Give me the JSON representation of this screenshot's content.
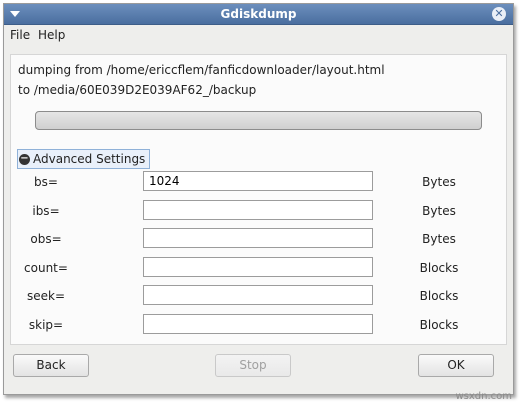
{
  "window": {
    "title": "Gdiskdump"
  },
  "menu": {
    "file": "File",
    "help": "Help"
  },
  "info": {
    "from": "dumping from  /home/ericcflem/fanficdownloader/layout.html",
    "to": "to  /media/60E039D2E039AF62_/backup"
  },
  "progress": {
    "percent": 0
  },
  "advanced": {
    "label": "Advanced Settings",
    "expanded": true
  },
  "rows": [
    {
      "label": "bs=",
      "value": "1024",
      "unit": "Bytes"
    },
    {
      "label": "ibs=",
      "value": "",
      "unit": "Bytes"
    },
    {
      "label": "obs=",
      "value": "",
      "unit": "Bytes"
    },
    {
      "label": "count=",
      "value": "",
      "unit": "Blocks"
    },
    {
      "label": "seek=",
      "value": "",
      "unit": "Blocks"
    },
    {
      "label": "skip=",
      "value": "",
      "unit": "Blocks"
    }
  ],
  "buttons": {
    "back": "Back",
    "stop": "Stop",
    "ok": "OK"
  },
  "watermark": "wsxdn.com",
  "colors": {
    "titlebar": "#5a7fb0",
    "accent": "#6c8fbd"
  }
}
